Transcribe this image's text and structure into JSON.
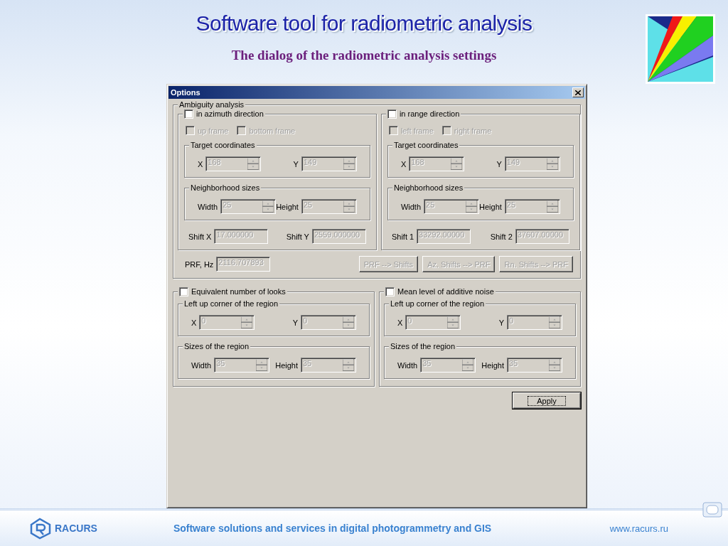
{
  "slide": {
    "title": "Software tool for radiometric analysis",
    "subtitle": "The dialog of the radiometric analysis settings"
  },
  "dialog": {
    "title": "Options",
    "ambiguity": {
      "label": "Ambiguity analysis",
      "panels": [
        {
          "checkbox": {
            "label": "in azimuth direction",
            "checked": false
          },
          "frames": [
            {
              "label": "up frame",
              "checked": false,
              "disabled": true
            },
            {
              "label": "bottom frame",
              "checked": false,
              "disabled": true
            }
          ],
          "groups": [
            {
              "label": "Target coordinates",
              "fields": [
                {
                  "label": "X",
                  "value": "168",
                  "disabled": true
                },
                {
                  "label": "Y",
                  "value": "149",
                  "disabled": true
                }
              ]
            },
            {
              "label": "Neighborhood sizes",
              "fields": [
                {
                  "label": "Width",
                  "value": "25",
                  "disabled": true
                },
                {
                  "label": "Height",
                  "value": "25",
                  "disabled": true
                }
              ]
            }
          ],
          "shifts": [
            {
              "label": "Shift X",
              "value": "17.000000",
              "disabled": true
            },
            {
              "label": "Shift Y",
              "value": "2559.000000",
              "disabled": true
            }
          ]
        },
        {
          "checkbox": {
            "label": "in range direction",
            "checked": false
          },
          "frames": [
            {
              "label": "left frame",
              "checked": false,
              "disabled": true
            },
            {
              "label": "right frame",
              "checked": false,
              "disabled": true
            }
          ],
          "groups": [
            {
              "label": "Target coordinates",
              "fields": [
                {
                  "label": "X",
                  "value": "168",
                  "disabled": true
                },
                {
                  "label": "Y",
                  "value": "149",
                  "disabled": true
                }
              ]
            },
            {
              "label": "Neighborhood sizes",
              "fields": [
                {
                  "label": "Width",
                  "value": "25",
                  "disabled": true
                },
                {
                  "label": "Height",
                  "value": "25",
                  "disabled": true
                }
              ]
            }
          ],
          "shifts": [
            {
              "label": "Shift 1",
              "value": "33292.00000",
              "disabled": true
            },
            {
              "label": "Shift 2",
              "value": "37607.00000",
              "disabled": true
            }
          ]
        }
      ],
      "prf": {
        "label": "PRF, Hz",
        "value": "2116.707893",
        "disabled": true
      },
      "buttons": [
        {
          "label": "PRF --> Shifts",
          "disabled": true
        },
        {
          "label": "Az. Shifts --> PRF",
          "disabled": true
        },
        {
          "label": "Rn. Shifts --> PRF",
          "disabled": true
        }
      ]
    },
    "region_panels": [
      {
        "checkbox": {
          "label": "Equivalent number of looks",
          "checked": false
        },
        "groups": [
          {
            "label": "Left up corner of the region",
            "fields": [
              {
                "label": "X",
                "value": "0",
                "disabled": true
              },
              {
                "label": "Y",
                "value": "0",
                "disabled": true
              }
            ]
          },
          {
            "label": "Sizes of the region",
            "fields": [
              {
                "label": "Width",
                "value": "35",
                "disabled": true
              },
              {
                "label": "Height",
                "value": "35",
                "disabled": true
              }
            ]
          }
        ]
      },
      {
        "checkbox": {
          "label": "Mean level of additive noise",
          "checked": false
        },
        "groups": [
          {
            "label": "Left up corner of the region",
            "fields": [
              {
                "label": "X",
                "value": "0",
                "disabled": true
              },
              {
                "label": "Y",
                "value": "0",
                "disabled": true
              }
            ]
          },
          {
            "label": "Sizes of the region",
            "fields": [
              {
                "label": "Width",
                "value": "35",
                "disabled": true
              },
              {
                "label": "Height",
                "value": "35",
                "disabled": true
              }
            ]
          }
        ]
      }
    ],
    "apply": {
      "label": "Apply",
      "disabled": false
    }
  },
  "footer": {
    "brand": "RACURS",
    "tagline": "Software solutions and services in digital photogrammetry and GIS",
    "url": "www.racurs.ru"
  }
}
